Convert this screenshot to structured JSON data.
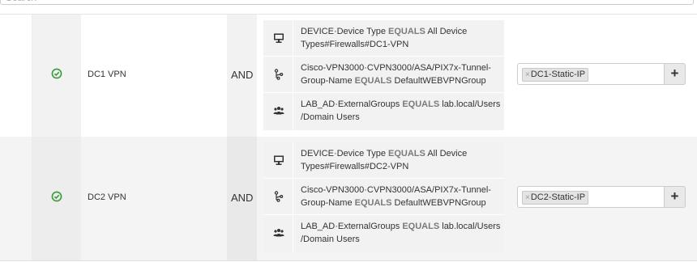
{
  "search": {
    "placeholder": "Search"
  },
  "rules": [
    {
      "status_icon": "check-circle-icon",
      "status_color": "#3a9a3a",
      "name": "DC1 VPN",
      "operator": "AND",
      "conditions": [
        {
          "icon": "device-icon",
          "attribute": "DEVICE·Device Type",
          "op": "EQUALS",
          "value": "All Device Types#Firewalls#DC1-VPN"
        },
        {
          "icon": "network-attribute-icon",
          "attribute": "Cisco-VPN3000·CVPN3000/ASA/PIX7x-Tunnel-Group-Name",
          "op": "EQUALS",
          "value": "DefaultWEBVPNGroup"
        },
        {
          "icon": "group-icon",
          "attribute": "LAB_AD·ExternalGroups",
          "op": "EQUALS",
          "value": "lab.local/Users /Domain Users"
        }
      ],
      "result_tag": "DC1-Static-IP",
      "add_label": "+"
    },
    {
      "status_icon": "check-circle-icon",
      "status_color": "#3a9a3a",
      "name": "DC2 VPN",
      "operator": "AND",
      "conditions": [
        {
          "icon": "device-icon",
          "attribute": "DEVICE·Device Type",
          "op": "EQUALS",
          "value": "All Device Types#Firewalls#DC2-VPN"
        },
        {
          "icon": "network-attribute-icon",
          "attribute": "Cisco-VPN3000·CVPN3000/ASA/PIX7x-Tunnel-Group-Name",
          "op": "EQUALS",
          "value": "DefaultWEBVPNGroup"
        },
        {
          "icon": "group-icon",
          "attribute": "LAB_AD·ExternalGroups",
          "op": "EQUALS",
          "value": "lab.local/Users /Domain Users"
        }
      ],
      "result_tag": "DC2-Static-IP",
      "add_label": "+"
    }
  ]
}
